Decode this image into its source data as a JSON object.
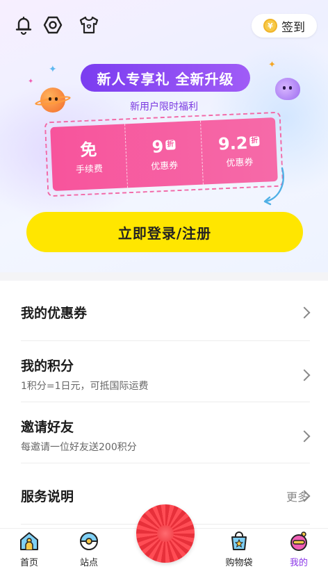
{
  "header": {
    "signin_label": "签到",
    "coin_symbol": "¥"
  },
  "promo": {
    "title": "新人专享礼 全新升级",
    "subtitle": "新用户限时福利",
    "tickets": [
      {
        "big": "免",
        "badge": "",
        "label": "手续费"
      },
      {
        "big": "9",
        "badge": "折",
        "label": "优惠券"
      },
      {
        "big": "9.2",
        "badge": "折",
        "label": "优惠券"
      }
    ],
    "login_label": "立即登录/注册"
  },
  "menu": {
    "items": [
      {
        "title": "我的优惠券",
        "desc": ""
      },
      {
        "title": "我的积分",
        "desc": "1积分=1日元，可抵国际运费"
      },
      {
        "title": "邀请好友",
        "desc": "每邀请一位好友送200积分"
      },
      {
        "title": "服务说明",
        "desc": "",
        "more": "更多"
      }
    ]
  },
  "tabbar": {
    "tabs": [
      {
        "label": "首页",
        "icon": "home-icon"
      },
      {
        "label": "站点",
        "icon": "station-icon"
      },
      {
        "label": "购物袋",
        "icon": "shopping-bag-icon"
      },
      {
        "label": "我的",
        "icon": "profile-icon",
        "active": true
      }
    ]
  },
  "colors": {
    "accent_purple": "#8a35e8",
    "button_yellow": "#ffe600",
    "ticket_pink": "#f7549c",
    "fab_red": "#e7303a"
  }
}
